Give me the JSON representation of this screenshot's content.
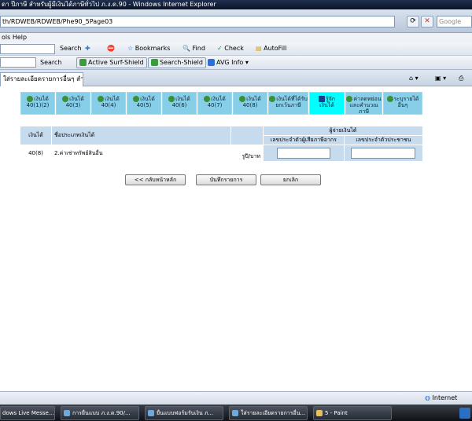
{
  "window": {
    "title": "ดา ปีภาษี สำหรับผู้มีเงินได้ภาษีทั่วไป ภ.ง.ด.90 - Windows Internet Explorer"
  },
  "address": {
    "url": "th/RDWEB/RDWEB/Phe90_5Page03",
    "search_placeholder": "Google"
  },
  "menu": {
    "label": "ols  Help"
  },
  "toolbar1": {
    "search_label": "Search",
    "bookmarks": "Bookmarks",
    "find": "Find",
    "check": "Check",
    "autofill": "AutoFill"
  },
  "toolbar2": {
    "search_label": "Search",
    "active_shield": "Active Surf-Shield",
    "search_shield": "Search-Shield",
    "avg": "AVG Info"
  },
  "tab": {
    "title": "ใส่รายละเอียดรายการอื่นๆ สำหรั..."
  },
  "nav_tabs": [
    {
      "line1": "เงินได้",
      "line2": "40(1)(2)"
    },
    {
      "line1": "เงินได้",
      "line2": "40(3)"
    },
    {
      "line1": "เงินได้",
      "line2": "40(4)"
    },
    {
      "line1": "เงินได้",
      "line2": "40(5)"
    },
    {
      "line1": "เงินได้",
      "line2": "40(6)"
    },
    {
      "line1": "เงินได้",
      "line2": "40(7)"
    },
    {
      "line1": "เงินได้",
      "line2": "40(8)"
    },
    {
      "line1": "เงินได้ที่ได้รับ",
      "line2": "ยกเว้นภาษี"
    },
    {
      "line1": "รู้จัก",
      "line2": "เงินได้"
    },
    {
      "line1": "ค่าลดหย่อน",
      "line2": "และคำนวณภาษี"
    },
    {
      "line1": "ระบุรายได้",
      "line2": "อื่นๆ"
    }
  ],
  "table": {
    "col_type": "เงินได้",
    "col_name": "ชื่อประเภทเงินได้",
    "group_header": "ผู้จ่ายเงินได้",
    "sub_header1": "เลขประจำตัวผู้เสียภาษีอากร",
    "sub_header2": "เลขประจำตัวประชาชน",
    "row": {
      "type": "40(8)",
      "name": "2.ค่าเช่าทรัพย์สินอื่น",
      "currency": "รูปี/บาท"
    }
  },
  "buttons": {
    "back": "<< กลับหน้าหลัก",
    "save": "บันทึกรายการ",
    "cancel": "ยกเลิก"
  },
  "status": {
    "zone": "Internet"
  },
  "taskbar": [
    {
      "label": "dows Live Messe..."
    },
    {
      "label": "การยื่นแบบ ภ.ง.ด.90/..."
    },
    {
      "label": "ยื่นแบบฟอร์มรับเงิน ภ..."
    },
    {
      "label": "ใส่รายละเอียดรายการอื่น..."
    },
    {
      "label": "5 - Paint"
    }
  ]
}
